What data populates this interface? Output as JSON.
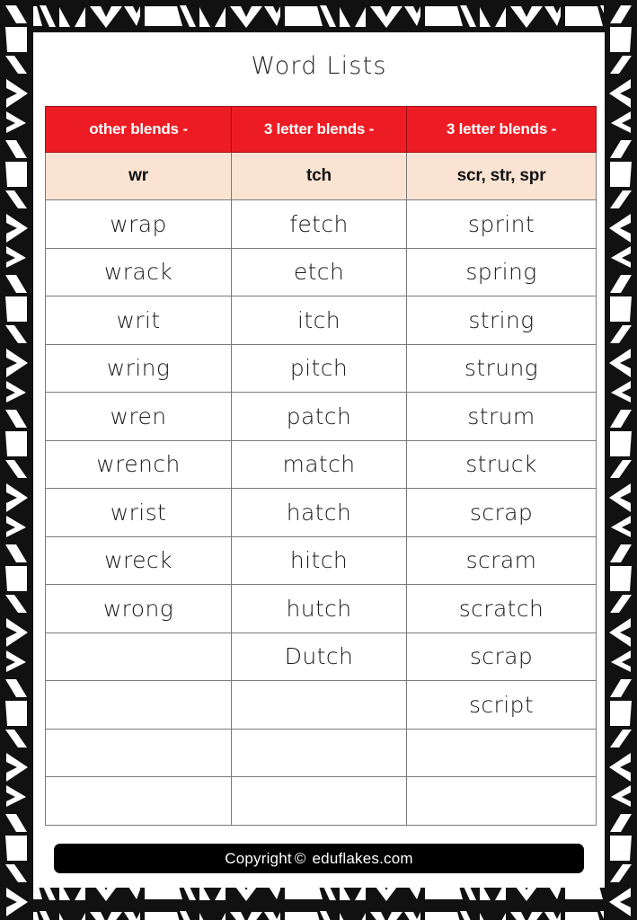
{
  "page": {
    "title": "Word Lists",
    "background_color": "#ffffff",
    "border_style": "tribal-aztec-black-white"
  },
  "colors": {
    "header_red": "#ED1C24",
    "subheader_peach": "#FAE3D3",
    "grid_line": "#7a7a7a",
    "footer_bar": "#000000",
    "text_dark": "#1a1a1a"
  },
  "table": {
    "headers": [
      "other blends -",
      "3 letter blends -",
      "3 letter blends -"
    ],
    "subheaders": [
      "wr",
      "tch",
      "scr, str, spr"
    ],
    "row_count": 13,
    "columns": [
      {
        "header": "other blends -",
        "subheader": "wr",
        "words": [
          "wrap",
          "wrack",
          "writ",
          "wring",
          "wren",
          "wrench",
          "wrist",
          "wreck",
          "wrong",
          "",
          "",
          "",
          ""
        ]
      },
      {
        "header": "3 letter blends -",
        "subheader": "tch",
        "words": [
          "fetch",
          "etch",
          "itch",
          "pitch",
          "patch",
          "match",
          "hatch",
          "hitch",
          "hutch",
          "Dutch",
          "",
          "",
          ""
        ]
      },
      {
        "header": "3 letter blends -",
        "subheader": "scr, str, spr",
        "words": [
          "sprint",
          "spring",
          "string",
          "strung",
          "strum",
          "struck",
          "scrap",
          "scram",
          "scratch",
          "scrap",
          "script",
          "",
          ""
        ]
      }
    ]
  },
  "footer": {
    "copyright_word": "Copyright",
    "copyright_symbol": "©",
    "site": "eduflakes.com"
  }
}
